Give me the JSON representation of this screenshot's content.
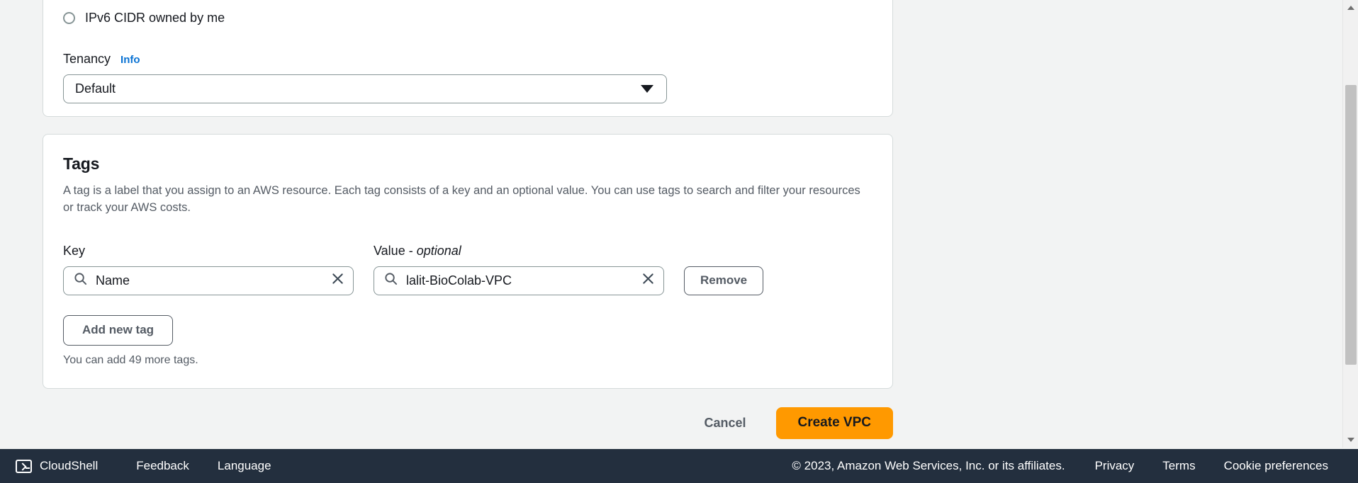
{
  "top_panel": {
    "radio_option_label": "IPv6 CIDR owned by me",
    "tenancy_label": "Tenancy",
    "info_label": "Info",
    "tenancy_value": "Default"
  },
  "tags": {
    "title": "Tags",
    "description": "A tag is a label that you assign to an AWS resource. Each tag consists of a key and an optional value. You can use tags to search and filter your resources or track your AWS costs.",
    "key_label": "Key",
    "value_label_prefix": "Value - ",
    "value_label_emphasis": "optional",
    "rows": [
      {
        "key_value": "Name",
        "value_value": "lalit-BioColab-VPC",
        "remove_label": "Remove"
      }
    ],
    "add_new_tag_label": "Add new tag",
    "remaining_hint": "You can add 49 more tags."
  },
  "actions": {
    "cancel_label": "Cancel",
    "create_label": "Create VPC"
  },
  "footer": {
    "cloudshell_label": "CloudShell",
    "feedback_label": "Feedback",
    "language_label": "Language",
    "copyright": "© 2023, Amazon Web Services, Inc. or its affiliates.",
    "privacy_label": "Privacy",
    "terms_label": "Terms",
    "cookie_label": "Cookie preferences"
  },
  "theme": {
    "primary_button_bg": "#ff9900",
    "footer_bg": "#232f3e",
    "link_blue": "#0972d3",
    "page_bg": "#f2f3f3"
  }
}
